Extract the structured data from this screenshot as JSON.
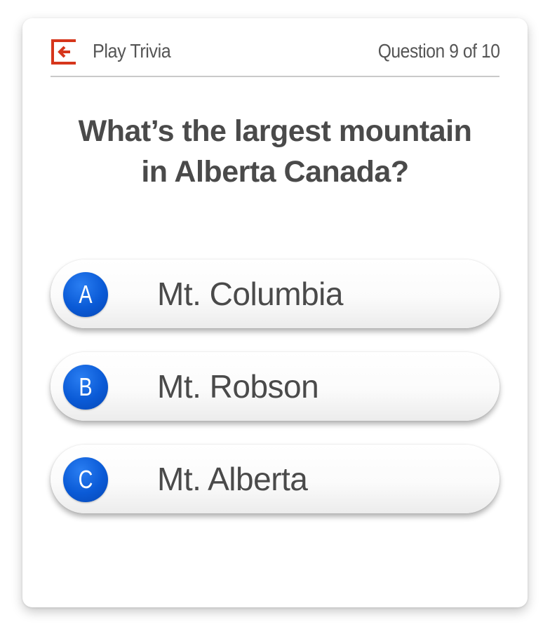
{
  "header": {
    "exit_icon": "exit-arrow-icon",
    "title": "Play Trivia",
    "progress": "Question 9 of 10"
  },
  "question": {
    "line1": "What’s the largest mountain",
    "line2": "in Alberta Canada?"
  },
  "answers": [
    {
      "letter": "A",
      "text": "Mt. Columbia"
    },
    {
      "letter": "B",
      "text": "Mt. Robson"
    },
    {
      "letter": "C",
      "text": "Mt. Alberta"
    }
  ],
  "colors": {
    "accent_red": "#d6361c",
    "badge_blue": "#0a5ad6",
    "text_gray": "#4a4a4a"
  }
}
